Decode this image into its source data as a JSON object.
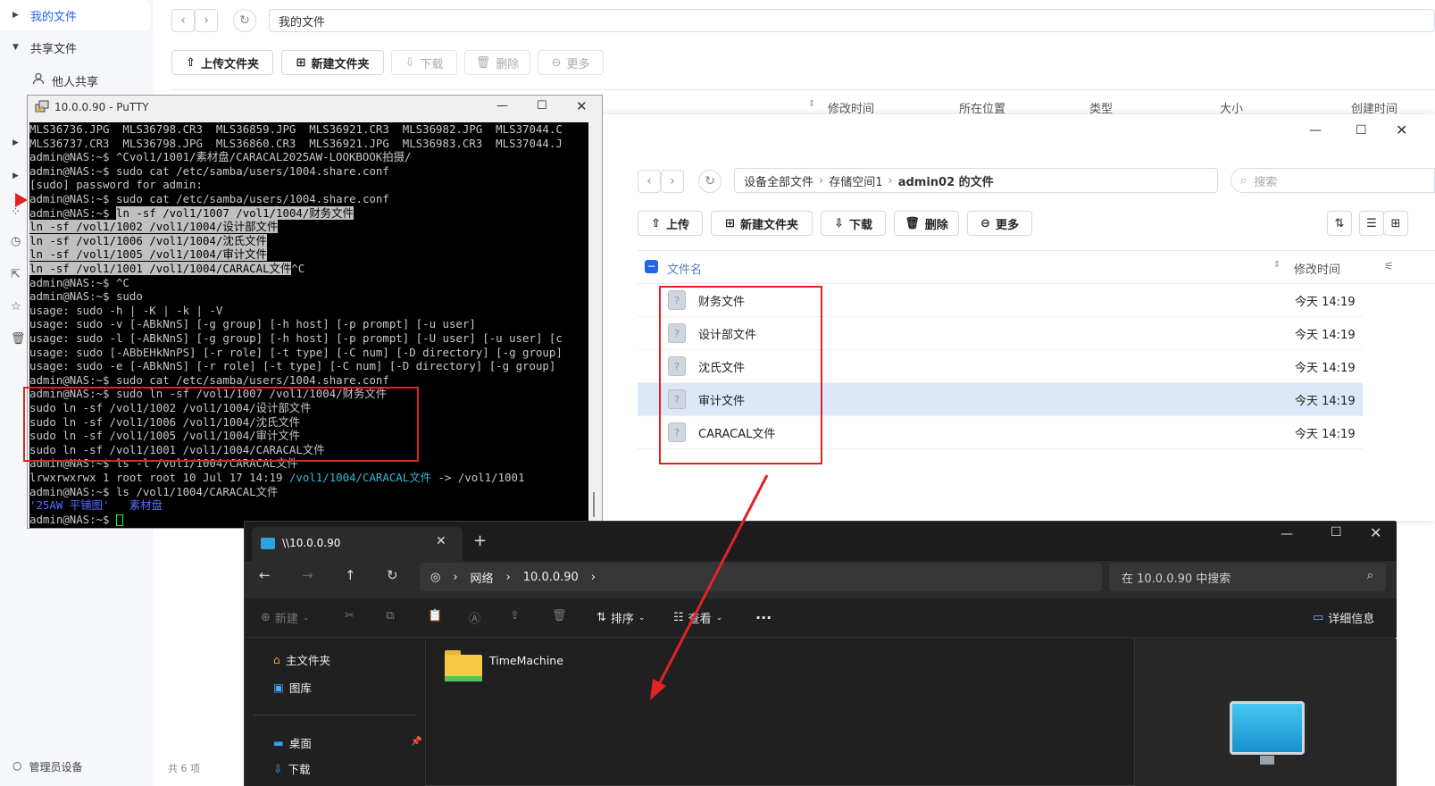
{
  "bg_app": {
    "sidebar": {
      "my_files": "我的文件",
      "shared_files": "共享文件",
      "others": "他人共享",
      "admin_device": "管理员设备"
    },
    "path": "我的文件",
    "toolbar": {
      "upload_folder": "上传文件夹",
      "new_folder": "新建文件夹",
      "download": "下载",
      "delete": "删除",
      "more": "更多"
    },
    "columns": [
      "修改时间",
      "所在位置",
      "类型",
      "大小",
      "创建时间"
    ],
    "footer_count": "共 6 项"
  },
  "putty": {
    "title": "10.0.0.90 - PuTTY",
    "lines": [
      "MLS36736.JPG  MLS36798.CR3  MLS36859.JPG  MLS36921.CR3  MLS36982.JPG  MLS37044.C",
      "MLS36737.CR3  MLS36798.JPG  MLS36860.CR3  MLS36921.JPG  MLS36983.CR3  MLS37044.J",
      "admin@NAS:~$ ^Cvol1/1001/素材盘/CARACAL2025AW-LOOKBOOK拍摄/",
      "admin@NAS:~$ sudo cat /etc/samba/users/1004.share.conf",
      "[sudo] password for admin:",
      "admin@NAS:~$ sudo cat /etc/samba/users/1004.share.conf",
      "admin@NAS:~$ ",
      "ln -sf /vol1/1002 /vol1/1004/设计部文件",
      "ln -sf /vol1/1006 /vol1/1004/沈氏文件",
      "ln -sf /vol1/1005 /vol1/1004/审计文件",
      "ln -sf /vol1/1001 /vol1/1004/CARACAL文件",
      "admin@NAS:~$ ^C",
      "admin@NAS:~$ sudo",
      "usage: sudo -h | -K | -k | -V",
      "usage: sudo -v [-ABkNnS] [-g group] [-h host] [-p prompt] [-u user]",
      "usage: sudo -l [-ABkNnS] [-g group] [-h host] [-p prompt] [-U user] [-u user] [c",
      "usage: sudo [-ABbEHkNnPS] [-r role] [-t type] [-C num] [-D directory] [-g group]",
      "usage: sudo -e [-ABkNnS] [-r role] [-t type] [-C num] [-D directory] [-g group]",
      "admin@NAS:~$ sudo cat /etc/samba/users/1004.share.conf",
      "admin@NAS:~$ sudo ln -sf /vol1/1007 /vol1/1004/财务文件",
      "sudo ln -sf /vol1/1002 /vol1/1004/设计部文件",
      "sudo ln -sf /vol1/1006 /vol1/1004/沈氏文件",
      "sudo ln -sf /vol1/1005 /vol1/1004/审计文件",
      "sudo ln -sf /vol1/1001 /vol1/1004/CARACAL文件",
      "admin@NAS:~$ ls -l /vol1/1004/CARACAL文件",
      "lrwxrwxrwx 1 root root 10 Jul 17 14:19 ",
      "admin@NAS:~$ ls /vol1/1004/CARACAL文件",
      "",
      "admin@NAS:~$ "
    ],
    "line6_hl": "ln -sf /vol1/1007 /vol1/1004/财务文件",
    "line10_tail": "^C",
    "link_target": "/vol1/1004/CARACAL文件",
    "link_arrow": " -> /vol1/1001",
    "ls_out_a": "'25AW 平铺图'",
    "ls_out_b": "素材盘"
  },
  "fm2": {
    "breadcrumb": [
      "设备全部文件",
      "存储空间1",
      "admin02 的文件"
    ],
    "search_placeholder": "搜索",
    "toolbar": {
      "upload": "上传",
      "new_folder": "新建文件夹",
      "download": "下载",
      "delete": "删除",
      "more": "更多"
    },
    "col_name": "文件名",
    "col_time": "修改时间",
    "files": [
      {
        "name": "财务文件",
        "time": "今天 14:19"
      },
      {
        "name": "设计部文件",
        "time": "今天 14:19"
      },
      {
        "name": "沈氏文件",
        "time": "今天 14:19"
      },
      {
        "name": "审计文件",
        "time": "今天 14:19"
      },
      {
        "name": "CARACAL文件",
        "time": "今天 14:19"
      }
    ],
    "selected_index": 3
  },
  "explorer": {
    "tab_title": "\\\\10.0.0.90",
    "address": [
      "网络",
      "10.0.0.90"
    ],
    "search_placeholder": "在 10.0.0.90 中搜索",
    "toolbar": {
      "new": "新建",
      "sort": "排序",
      "view": "查看",
      "details": "详细信息"
    },
    "nav": {
      "home": "主文件夹",
      "gallery": "图库",
      "desktop": "桌面",
      "downloads": "下载"
    },
    "items": [
      {
        "name": "TimeMachine",
        "icon": "folder-icon"
      }
    ]
  },
  "colors": {
    "annotation_red": "#e02424",
    "accent_blue": "#2563eb",
    "selection": "#dde7f7"
  }
}
